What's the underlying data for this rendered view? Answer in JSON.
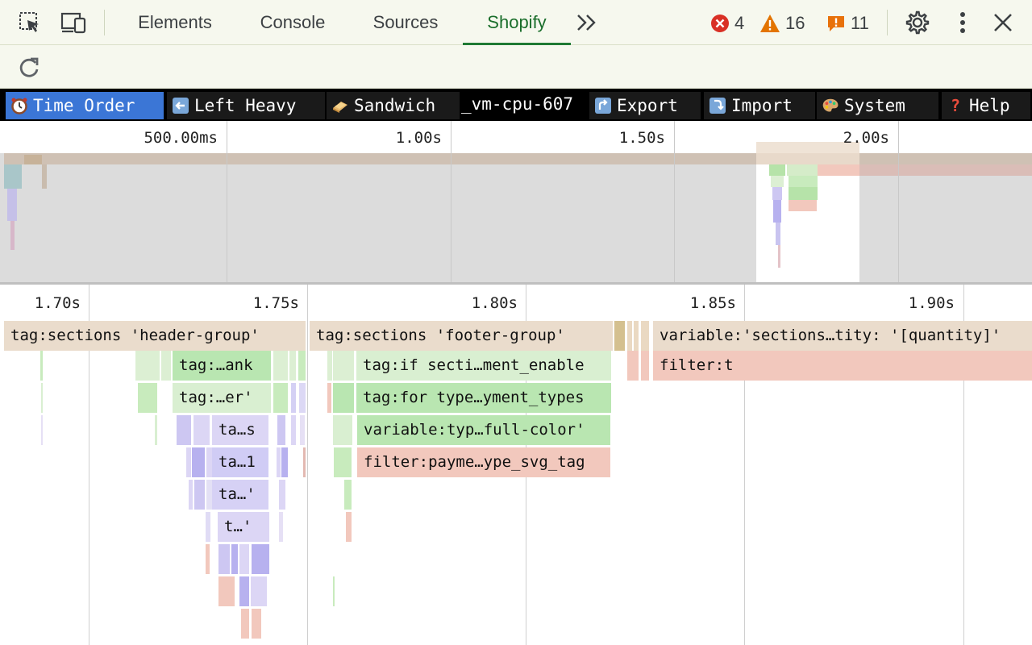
{
  "devtools": {
    "tabs": [
      {
        "label": "Elements",
        "active": false
      },
      {
        "label": "Console",
        "active": false
      },
      {
        "label": "Sources",
        "active": false
      },
      {
        "label": "Shopify",
        "active": true
      }
    ],
    "more_tabs_icon": "double-chevron-right-icon",
    "errors": "4",
    "warnings": "16",
    "issues": "11",
    "colors": {
      "active_tab": "#1a6e2b",
      "error": "#d93025",
      "warning": "#e37400",
      "issue": "#e8710a"
    }
  },
  "toolbar": {
    "buttons": [
      {
        "label": "Time Order",
        "icon": "clock-icon",
        "active": true
      },
      {
        "label": "Left Heavy",
        "icon": "left-arrow-icon",
        "active": false
      },
      {
        "label": "Sandwich",
        "icon": "sandwich-icon",
        "active": false
      },
      {
        "label": "Export",
        "icon": "export-icon",
        "active": false
      },
      {
        "label": "Import",
        "icon": "import-icon",
        "active": false
      },
      {
        "label": "System",
        "icon": "palette-icon",
        "active": false
      },
      {
        "label": "Help",
        "icon": "help-icon",
        "active": false
      }
    ],
    "profile_title": "_vm-cpu-607"
  },
  "overview": {
    "ticks": [
      "500.00ms",
      "1.00s",
      "1.50s",
      "2.00s"
    ]
  },
  "flame": {
    "ticks": [
      "1.70s",
      "1.75s",
      "1.80s",
      "1.85s",
      "1.90s"
    ],
    "frames": [
      {
        "label": "tag:sections 'header-group'",
        "row": 0,
        "color": "#eadccc"
      },
      {
        "label": "tag:sections 'footer-group'",
        "row": 0,
        "color": "#eadccc"
      },
      {
        "label": "variable:'sections…tity: '[quantity]'",
        "row": 0,
        "color": "#eadccc"
      },
      {
        "label": "tag:…ank",
        "row": 1,
        "color": "#b9e6b1"
      },
      {
        "label": "tag:if secti…ment_enable",
        "row": 1,
        "color": "#d9efd1"
      },
      {
        "label": "filter:t",
        "row": 1,
        "color": "#f2c8bd"
      },
      {
        "label": "tag:…er'",
        "row": 2,
        "color": "#d9efd1"
      },
      {
        "label": "tag:for type…yment_types",
        "row": 2,
        "color": "#b9e6b1"
      },
      {
        "label": "ta…s",
        "row": 3,
        "color": "#dcd6f5"
      },
      {
        "label": "variable:typ…full-color'",
        "row": 3,
        "color": "#b9e6b1"
      },
      {
        "label": "ta…1",
        "row": 4,
        "color": "#d0ccf5"
      },
      {
        "label": "filter:payme…ype_svg_tag",
        "row": 4,
        "color": "#f2c8bd"
      },
      {
        "label": "ta…'",
        "row": 5,
        "color": "#d6d1f5"
      },
      {
        "label": "t…'",
        "row": 6,
        "color": "#dcd6f5"
      }
    ]
  }
}
